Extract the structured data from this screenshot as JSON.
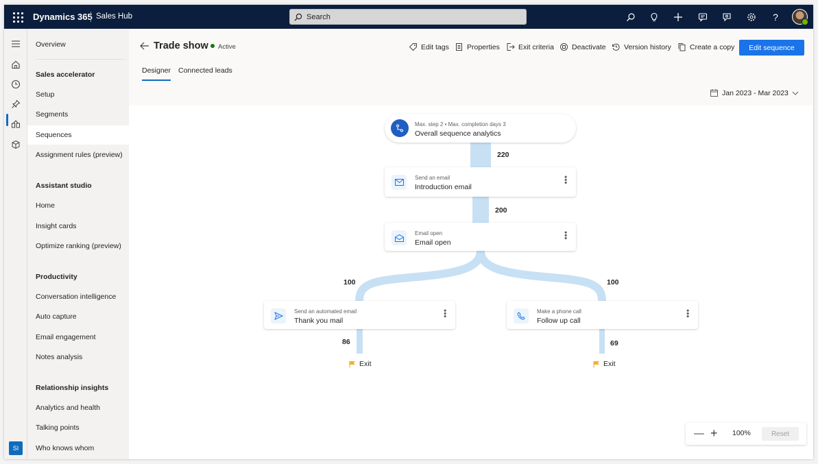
{
  "topbar": {
    "brand": "Dynamics 365",
    "app": "Sales Hub",
    "search_placeholder": "Search"
  },
  "sidebar": {
    "overview": "Overview",
    "groups": [
      {
        "head": "Sales accelerator",
        "items": [
          "Setup",
          "Segments",
          "Sequences",
          "Assignment rules (preview)"
        ]
      },
      {
        "head": "Assistant studio",
        "items": [
          "Home",
          "Insight cards",
          "Optimize ranking (preview)"
        ]
      },
      {
        "head": "Productivity",
        "items": [
          "Conversation intelligence",
          "Auto capture",
          "Email engagement",
          "Notes analysis"
        ]
      },
      {
        "head": "Relationship insights",
        "items": [
          "Analytics and health",
          "Talking points",
          "Who knows whom"
        ]
      }
    ],
    "active_item": "Sequences",
    "user_initials": "SI"
  },
  "header": {
    "title": "Trade show",
    "status": "Active",
    "commands": {
      "edit_tags": "Edit tags",
      "properties": "Properties",
      "exit_criteria": "Exit criteria",
      "deactivate": "Deactivate",
      "version_history": "Version history",
      "create_copy": "Create a copy"
    },
    "primary_button": "Edit sequence"
  },
  "tabs": {
    "designer": "Designer",
    "connected_leads": "Connected leads",
    "active": "Designer"
  },
  "date_range": "Jan 2023 - Mar 2023",
  "flow": {
    "overall": {
      "subtitle": "Max. step 2 • Max. completion days 3",
      "title": "Overall sequence analytics"
    },
    "count_1": "220",
    "step_1": {
      "subtitle": "Send an email",
      "title": "Introduction email"
    },
    "count_2": "200",
    "step_2": {
      "subtitle": "Email open",
      "title": "Email open"
    },
    "branch_left_count": "100",
    "branch_right_count": "100",
    "step_left": {
      "subtitle": "Send an automated email",
      "title": "Thank you mail"
    },
    "step_right": {
      "subtitle": "Make a phone call",
      "title": "Follow up call"
    },
    "exit_left_count": "86",
    "exit_right_count": "69",
    "exit_label": "Exit"
  },
  "zoom": {
    "level": "100%",
    "reset": "Reset"
  },
  "colors": {
    "topbar": "#0b1e3d",
    "accent": "#1a73e8",
    "flow": "#c7e0f4",
    "active_status": "#107c10",
    "exit_flag": "#f2b230"
  }
}
